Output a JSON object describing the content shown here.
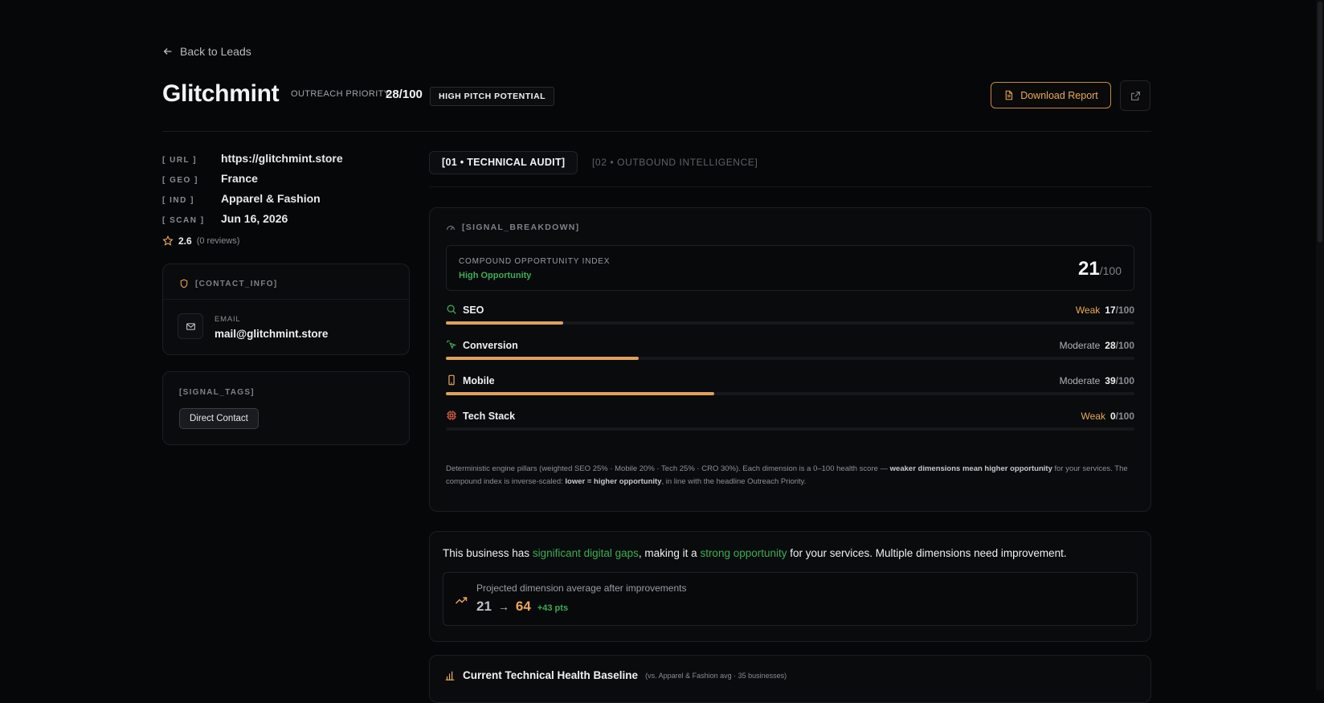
{
  "nav": {
    "back_label": "Back to Leads"
  },
  "header": {
    "title": "Glitchmint",
    "priority_label": "OUTREACH PRIORITY:",
    "priority_value": "28/100",
    "pitch_badge": "HIGH PITCH POTENTIAL",
    "download_label": "Download Report"
  },
  "meta": [
    {
      "key": "[ URL ]",
      "value": "https://glitchmint.store"
    },
    {
      "key": "[ GEO ]",
      "value": "France"
    },
    {
      "key": "[ IND ]",
      "value": "Apparel & Fashion"
    },
    {
      "key": "[ SCAN ]",
      "value": "Jun 16, 2026"
    }
  ],
  "rating": {
    "score": "2.6",
    "reviews": "(0 reviews)"
  },
  "contact": {
    "heading": "[CONTACT_INFO]",
    "email_label": "EMAIL",
    "email_value": "mail@glitchmint.store"
  },
  "tags": {
    "heading": "[SIGNAL_TAGS]",
    "items": [
      "Direct Contact"
    ]
  },
  "tabs": [
    {
      "label": "[01 • TECHNICAL AUDIT]",
      "active": true
    },
    {
      "label": "[02 • OUTBOUND INTELLIGENCE]",
      "active": false
    }
  ],
  "signal": {
    "heading": "[SIGNAL_BREAKDOWN]",
    "index_label": "COMPOUND OPPORTUNITY INDEX",
    "index_sub": "High Opportunity",
    "index_score": "21",
    "index_den": "/100",
    "dimensions": [
      {
        "name": "SEO",
        "status": "Weak",
        "score": "17",
        "den": "/100",
        "value": 17,
        "icon": "search-icon"
      },
      {
        "name": "Conversion",
        "status": "Moderate",
        "score": "28",
        "den": "/100",
        "value": 28,
        "icon": "cursor-click-icon"
      },
      {
        "name": "Mobile",
        "status": "Moderate",
        "score": "39",
        "den": "/100",
        "value": 39,
        "icon": "smartphone-icon"
      },
      {
        "name": "Tech Stack",
        "status": "Weak",
        "score": "0",
        "den": "/100",
        "value": 0,
        "icon": "cpu-icon"
      }
    ],
    "footnote": {
      "p1": "Deterministic engine pillars (weighted SEO 25% · Mobile 20% · Tech 25% · CRO 30%). Each dimension is a 0–100 health score — ",
      "b1": "weaker dimensions mean higher opportunity",
      "p2": " for your services. The compound index is inverse-scaled: ",
      "b2": "lower = higher opportunity",
      "p3": ", in line with the headline Outreach Priority."
    }
  },
  "summary": {
    "t1": "This business has ",
    "h1": "significant digital gaps",
    "t2": ", making it a ",
    "h2": "strong opportunity",
    "t3": " for your services. Multiple dimensions need improvement.",
    "projection_label": "Projected dimension average after improvements",
    "from": "21",
    "arrow": "→",
    "to": "64",
    "delta": "+43 pts"
  },
  "health": {
    "title": "Current Technical Health Baseline",
    "subtitle": "(vs. Apparel & Fashion avg · 35 businesses)"
  },
  "colors": {
    "accent_orange": "#e8a958",
    "accent_green": "#3dac57",
    "bar_fill": "#dfa25a",
    "background": "#060708"
  }
}
